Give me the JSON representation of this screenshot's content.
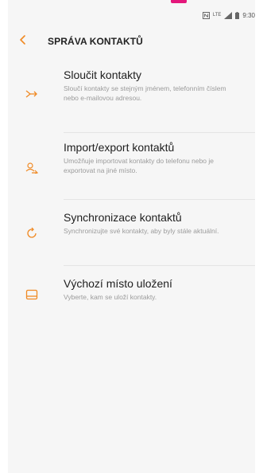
{
  "status_bar": {
    "time": "9:30",
    "network_label": "LTE"
  },
  "header": {
    "title": "SPRÁVA KONTAKTŮ"
  },
  "items": [
    {
      "title": "Sloučit kontakty",
      "description": "Sloučí kontakty se stejným jménem, telefonním číslem nebo e-mailovou adresou.",
      "icon": "merge-icon"
    },
    {
      "title": "Import/export kontaktů",
      "description": "Umožňuje importovat kontakty do telefonu nebo je exportovat na jiné místo.",
      "icon": "import-export-icon"
    },
    {
      "title": "Synchronizace kontaktů",
      "description": "Synchronizujte své kontakty, aby byly stále aktuální.",
      "icon": "sync-icon"
    },
    {
      "title": "Výchozí místo uložení",
      "description": "Vyberte, kam se uloží kontakty.",
      "icon": "storage-icon"
    }
  ],
  "colors": {
    "accent": "#f08a24",
    "background": "#f6f6f6",
    "title_text": "#202020",
    "description_text": "#9b9b9b"
  }
}
